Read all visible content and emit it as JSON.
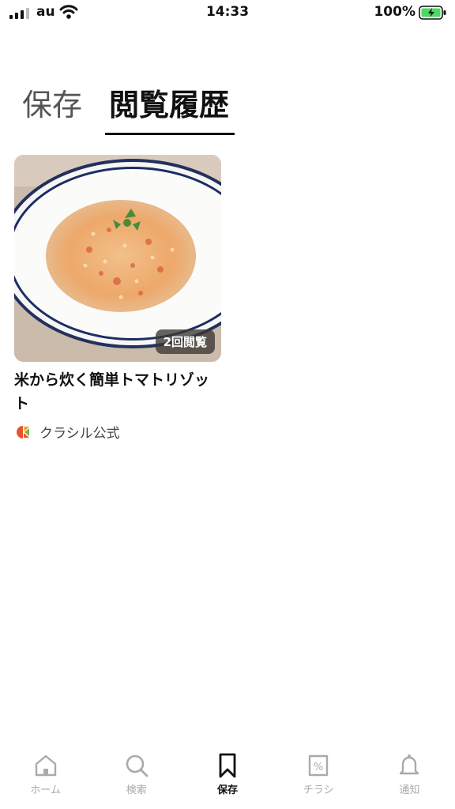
{
  "status_bar": {
    "carrier": "au",
    "time": "14:33",
    "battery": "100%"
  },
  "tabs": [
    {
      "label": "保存",
      "active": false
    },
    {
      "label": "閲覧履歴",
      "active": true
    }
  ],
  "history_items": [
    {
      "title": "米から炊く簡単トマトリゾット",
      "view_count": "2回閲覧",
      "author": "クラシル公式"
    }
  ],
  "bottom_nav": [
    {
      "label": "ホーム",
      "icon": "home-icon"
    },
    {
      "label": "検索",
      "icon": "search-icon"
    },
    {
      "label": "保存",
      "icon": "bookmark-icon",
      "active": true
    },
    {
      "label": "チラシ",
      "icon": "flyer-icon"
    },
    {
      "label": "通知",
      "icon": "bell-icon"
    }
  ]
}
